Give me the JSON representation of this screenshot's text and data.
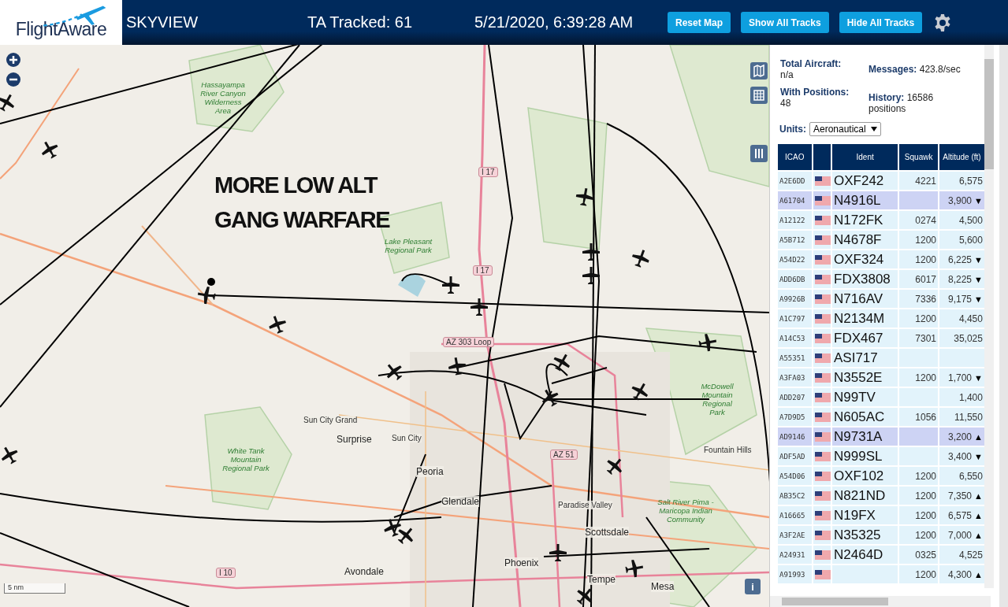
{
  "header": {
    "logo": "FlightAware",
    "title": "SKYVIEW",
    "tracked": "TA Tracked: 61",
    "datetime": "5/21/2020, 6:39:28 AM",
    "buttons": [
      "Reset Map",
      "Show All Tracks",
      "Hide All Tracks"
    ]
  },
  "map": {
    "annotation": "MORE LOW ALT\nGANG WARFARE",
    "scale": "5 nm",
    "info": "i",
    "labels": [
      {
        "kind": "park",
        "text": "Hassayampa River Canyon Wilderness Area"
      },
      {
        "kind": "park",
        "text": "Lake Pleasant Regional Park"
      },
      {
        "kind": "park",
        "text": "White Tank Mountain Regional Park"
      },
      {
        "kind": "park",
        "text": "McDowell Mountain Regional Park"
      },
      {
        "kind": "park",
        "text": "Salt River Pima - Maricopa Indian Community"
      },
      {
        "kind": "town",
        "text": "Sun City Grand"
      },
      {
        "kind": "city",
        "text": "Surprise"
      },
      {
        "kind": "town",
        "text": "Sun City"
      },
      {
        "kind": "city",
        "text": "Peoria"
      },
      {
        "kind": "city",
        "text": "Glendale"
      },
      {
        "kind": "town",
        "text": "Paradise Valley"
      },
      {
        "kind": "city",
        "text": "Scottsdale"
      },
      {
        "kind": "town",
        "text": "Fountain Hills"
      },
      {
        "kind": "city",
        "text": "Phoenix"
      },
      {
        "kind": "city",
        "text": "Tempe"
      },
      {
        "kind": "city",
        "text": "Mesa"
      },
      {
        "kind": "city",
        "text": "Avondale"
      },
      {
        "kind": "shield",
        "text": "I 17"
      },
      {
        "kind": "shield",
        "text": "I 17"
      },
      {
        "kind": "shield",
        "text": "AZ 303 Loop"
      },
      {
        "kind": "shield",
        "text": "AZ 51"
      },
      {
        "kind": "shield",
        "text": "I 10"
      }
    ]
  },
  "stats": [
    {
      "label": "Total Aircraft:",
      "value": "n/a"
    },
    {
      "label": "Messages:",
      "value": "423.8/sec"
    },
    {
      "label": "With Positions:",
      "value": "48"
    },
    {
      "label": "History:",
      "value": "16586 positions"
    }
  ],
  "units": {
    "label": "Units:",
    "value": "Aeronautical"
  },
  "table": {
    "columns": [
      "ICAO",
      "",
      "Ident",
      "Squawk",
      "Altitude (ft)"
    ],
    "rows": [
      {
        "icao": "A2E6DD",
        "ident": "OXF242",
        "squawk": "4221",
        "altitude": "6,575",
        "trend": "",
        "selected": false
      },
      {
        "icao": "A61704",
        "ident": "N4916L",
        "squawk": "",
        "altitude": "3,900",
        "trend": "▼",
        "selected": true
      },
      {
        "icao": "A12122",
        "ident": "N172FK",
        "squawk": "0274",
        "altitude": "4,500",
        "trend": "",
        "selected": false
      },
      {
        "icao": "A5B712",
        "ident": "N4678F",
        "squawk": "1200",
        "altitude": "5,600",
        "trend": "",
        "selected": false
      },
      {
        "icao": "A54D22",
        "ident": "OXF324",
        "squawk": "1200",
        "altitude": "6,225",
        "trend": "▼",
        "selected": false
      },
      {
        "icao": "ADD6DB",
        "ident": "FDX3808",
        "squawk": "6017",
        "altitude": "8,225",
        "trend": "▼",
        "selected": false
      },
      {
        "icao": "A9926B",
        "ident": "N716AV",
        "squawk": "7336",
        "altitude": "9,175",
        "trend": "▼",
        "selected": false
      },
      {
        "icao": "A1C797",
        "ident": "N2134M",
        "squawk": "1200",
        "altitude": "4,450",
        "trend": "",
        "selected": false
      },
      {
        "icao": "A14C53",
        "ident": "FDX467",
        "squawk": "7301",
        "altitude": "35,025",
        "trend": "",
        "selected": false
      },
      {
        "icao": "A55351",
        "ident": "ASI717",
        "squawk": "",
        "altitude": "",
        "trend": "",
        "selected": false
      },
      {
        "icao": "A3FA03",
        "ident": "N3552E",
        "squawk": "1200",
        "altitude": "1,700",
        "trend": "▼",
        "selected": false
      },
      {
        "icao": "ADD207",
        "ident": "N99TV",
        "squawk": "",
        "altitude": "1,400",
        "trend": "",
        "selected": false
      },
      {
        "icao": "A7D9D5",
        "ident": "N605AC",
        "squawk": "1056",
        "altitude": "11,550",
        "trend": "",
        "selected": false
      },
      {
        "icao": "AD9146",
        "ident": "N9731A",
        "squawk": "",
        "altitude": "3,200",
        "trend": "▲",
        "selected": true
      },
      {
        "icao": "ADF5AD",
        "ident": "N999SL",
        "squawk": "",
        "altitude": "3,400",
        "trend": "▼",
        "selected": false
      },
      {
        "icao": "A54D06",
        "ident": "OXF102",
        "squawk": "1200",
        "altitude": "6,550",
        "trend": "",
        "selected": false
      },
      {
        "icao": "AB35C2",
        "ident": "N821ND",
        "squawk": "1200",
        "altitude": "7,350",
        "trend": "▲",
        "selected": false
      },
      {
        "icao": "A16665",
        "ident": "N19FX",
        "squawk": "1200",
        "altitude": "6,575",
        "trend": "▲",
        "selected": false
      },
      {
        "icao": "A3F2AE",
        "ident": "N35325",
        "squawk": "1200",
        "altitude": "7,000",
        "trend": "▲",
        "selected": false
      },
      {
        "icao": "A24931",
        "ident": "N2464D",
        "squawk": "0325",
        "altitude": "4,525",
        "trend": "",
        "selected": false
      },
      {
        "icao": "A91993",
        "ident": "",
        "squawk": "1200",
        "altitude": "4,300",
        "trend": "▲",
        "selected": false
      }
    ]
  }
}
